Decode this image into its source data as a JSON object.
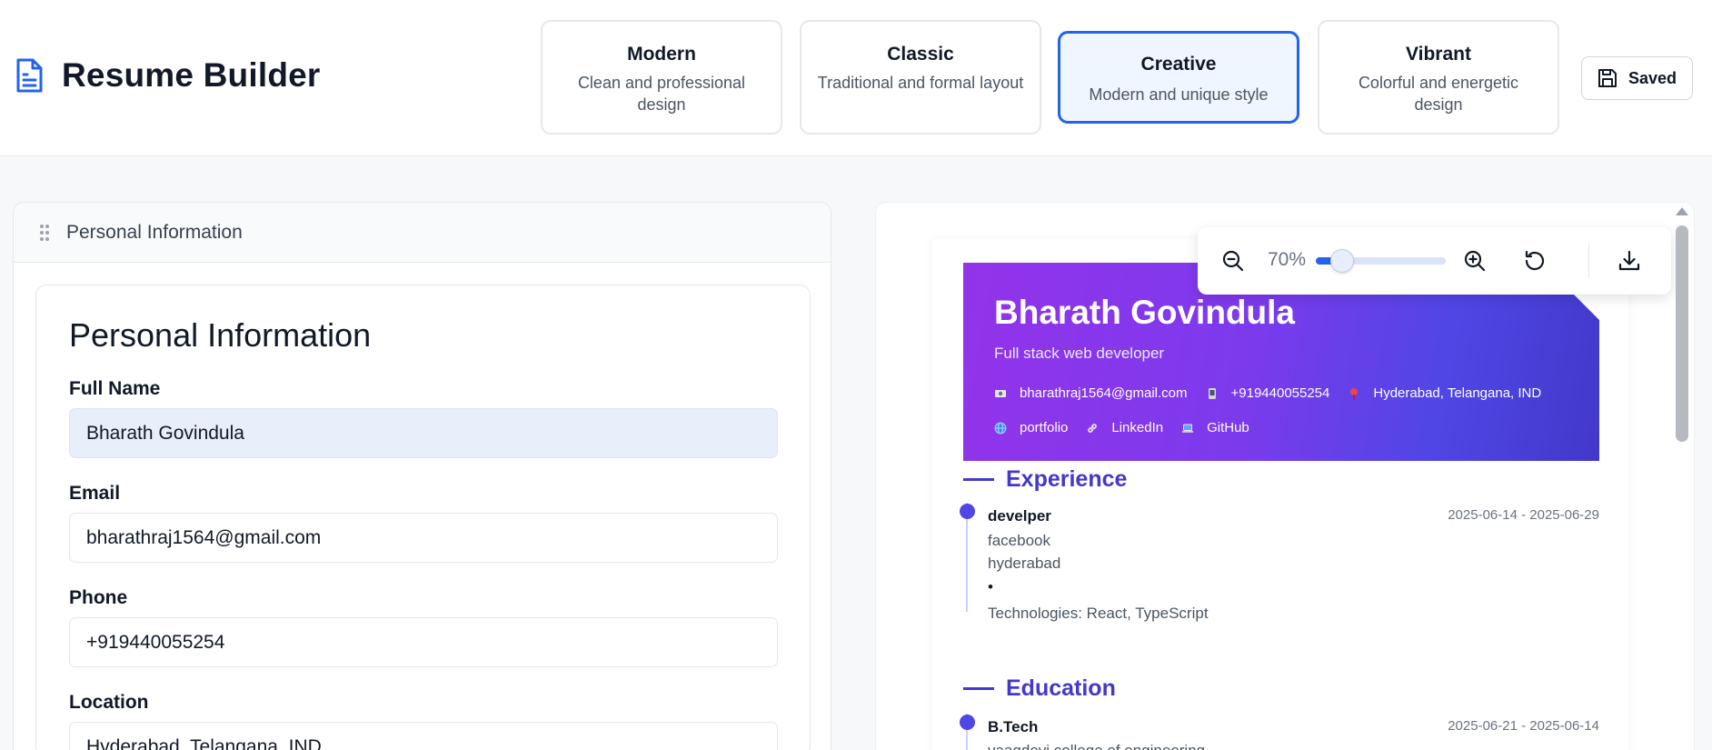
{
  "header": {
    "app_title": "Resume Builder",
    "templates": [
      {
        "name": "Modern",
        "desc": "Clean and professional design"
      },
      {
        "name": "Classic",
        "desc": "Traditional and formal layout"
      },
      {
        "name": "Creative",
        "desc": "Modern and unique style",
        "selected": true
      },
      {
        "name": "Vibrant",
        "desc": "Colorful and energetic design"
      }
    ],
    "saved_label": "Saved"
  },
  "editor": {
    "section_header": "Personal Information",
    "card_title": "Personal Information",
    "fields": {
      "full_name": {
        "label": "Full Name",
        "value": "Bharath Govindula"
      },
      "email": {
        "label": "Email",
        "value": "bharathraj1564@gmail.com"
      },
      "phone": {
        "label": "Phone",
        "value": "+919440055254"
      },
      "location": {
        "label": "Location",
        "value": "Hyderabad, Telangana, IND"
      }
    }
  },
  "preview": {
    "name": "Bharath Govindula",
    "title": "Full stack web developer",
    "contacts": {
      "email": "bharathraj1564@gmail.com",
      "phone": "+919440055254",
      "location": "Hyderabad, Telangana, IND",
      "portfolio": "portfolio",
      "linkedin": "LinkedIn",
      "github": "GitHub"
    },
    "experience": {
      "heading": "Experience",
      "role": "develper",
      "dates": "2025-06-14 - 2025-06-29",
      "company": "facebook",
      "location": "hyderabad",
      "bullet": "•",
      "technologies": "Technologies: React, TypeScript"
    },
    "education": {
      "heading": "Education",
      "degree": "B.Tech",
      "dates": "2025-06-21 - 2025-06-14",
      "school": "vaagdevi college of engineering"
    }
  },
  "toolbar": {
    "zoom_label": "70%",
    "zoom_level": 0.2
  },
  "colors": {
    "accent": "#2563eb",
    "banner_start": "#9333ea",
    "banner_end": "#4338ca",
    "section_heading": "#4338ca"
  },
  "icons": [
    "file-text-icon",
    "save-icon",
    "drag-handle-icon",
    "mail-icon",
    "phone-icon",
    "location-pin-icon",
    "globe-icon",
    "link-icon",
    "laptop-icon",
    "zoom-out-icon",
    "zoom-in-icon",
    "reset-icon",
    "download-icon"
  ]
}
